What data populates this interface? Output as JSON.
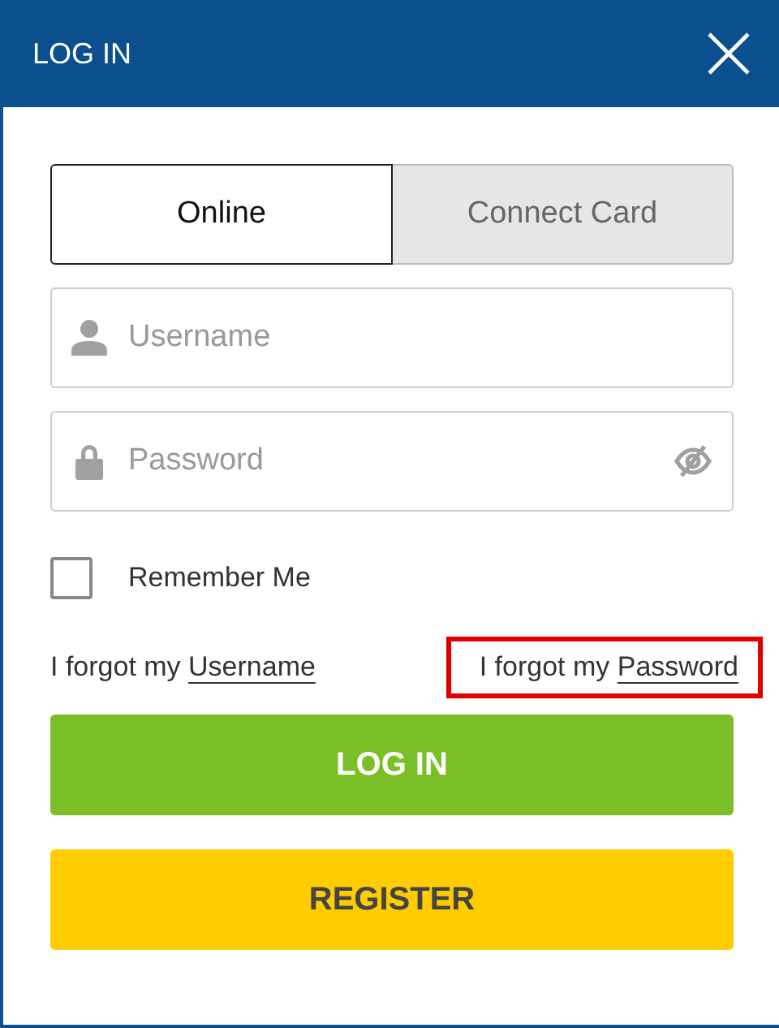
{
  "header": {
    "title": "LOG IN"
  },
  "tabs": [
    {
      "label": "Online",
      "selected": true
    },
    {
      "label": "Connect Card",
      "selected": false
    }
  ],
  "fields": [
    {
      "kind": "user",
      "placeholder": "Username"
    },
    {
      "kind": "password",
      "placeholder": "Password"
    }
  ],
  "remember": {
    "label": "Remember Me",
    "checked": false
  },
  "forgot": [
    {
      "prefix": "I forgot my ",
      "link": "Username",
      "highlighted": false
    },
    {
      "prefix": "I forgot my ",
      "link": "Password",
      "highlighted": true
    }
  ],
  "buttons": [
    {
      "kind": "primary",
      "label": "LOG IN"
    },
    {
      "kind": "secondary",
      "label": "REGISTER"
    }
  ]
}
